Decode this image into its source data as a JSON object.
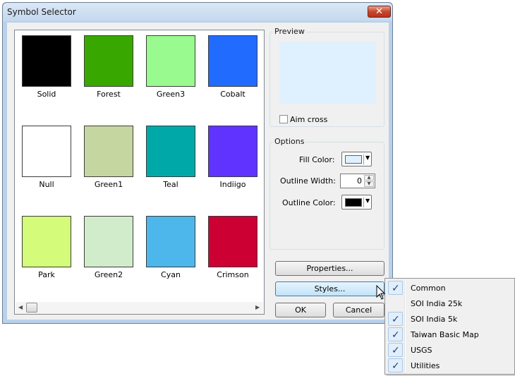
{
  "window": {
    "title": "Symbol Selector",
    "close_glyph": "✕"
  },
  "gallery": {
    "symbols": [
      {
        "label": "Solid",
        "color": "#000000"
      },
      {
        "label": "Forest",
        "color": "#38a800"
      },
      {
        "label": "Green3",
        "color": "#98fa8f"
      },
      {
        "label": "Cobalt",
        "color": "#216bff"
      },
      {
        "label": "Null",
        "color": "#ffffff"
      },
      {
        "label": "Green1",
        "color": "#c5d6a0"
      },
      {
        "label": "Teal",
        "color": "#00a8a8"
      },
      {
        "label": "Indiigo",
        "color": "#6133ff"
      },
      {
        "label": "Park",
        "color": "#d4fb7a"
      },
      {
        "label": "Green2",
        "color": "#d1ecca"
      },
      {
        "label": "Cyan",
        "color": "#4db6ea"
      },
      {
        "label": "Crimson",
        "color": "#cc0033"
      }
    ],
    "scroll_left": "◀",
    "scroll_right": "▶"
  },
  "preview": {
    "group_label": "Preview",
    "fill_color": "#dff0fe",
    "aim_cross_label": "Aim cross",
    "aim_cross_checked": false
  },
  "options": {
    "group_label": "Options",
    "fill_color_label": "Fill Color:",
    "fill_color": "#dff0fe",
    "outline_width_label": "Outline Width:",
    "outline_width": "0",
    "outline_color_label": "Outline Color:",
    "outline_color": "#000000"
  },
  "buttons": {
    "properties": "Properties...",
    "styles": "Styles...",
    "ok": "OK",
    "cancel": "Cancel"
  },
  "styles_menu": {
    "items": [
      {
        "label": "Common",
        "checked": true
      },
      {
        "label": "SOI India 25k",
        "checked": false
      },
      {
        "label": "SOI India 5k",
        "checked": true
      },
      {
        "label": "Taiwan Basic Map",
        "checked": true
      },
      {
        "label": "USGS",
        "checked": true
      },
      {
        "label": "Utilities",
        "checked": true
      }
    ],
    "check_glyph": "✓"
  },
  "icons": {
    "dropdown_arrow": "▼",
    "spin_up": "▲",
    "spin_down": "▼"
  }
}
